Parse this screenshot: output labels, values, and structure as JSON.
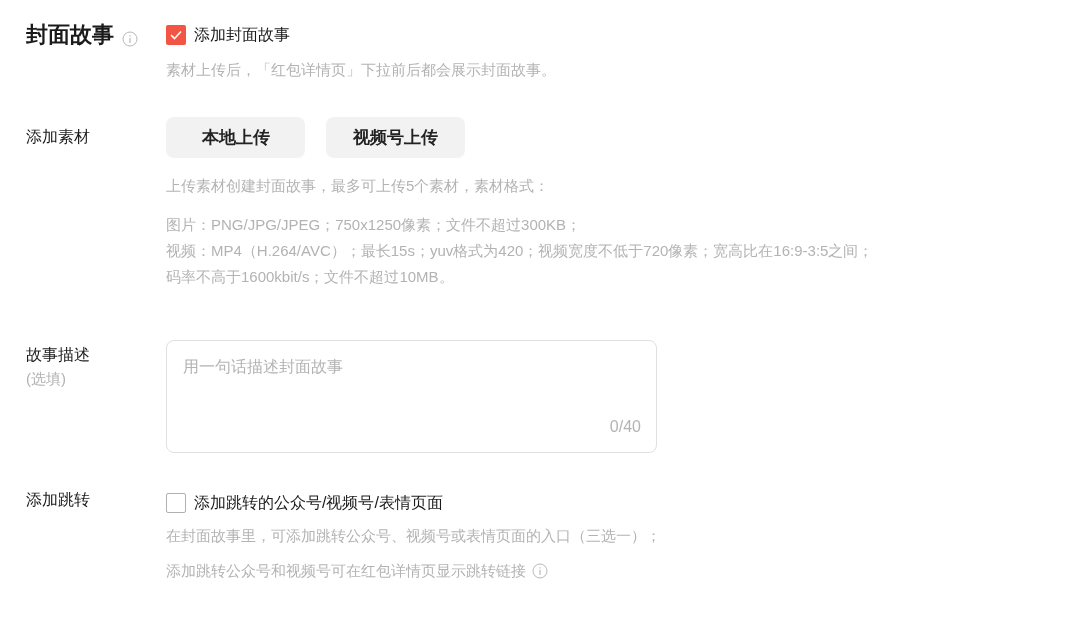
{
  "cover_story": {
    "title": "封面故事",
    "checkbox": {
      "label": "添加封面故事",
      "checked": true
    },
    "hint": "素材上传后，「红包详情页」下拉前后都会展示封面故事。"
  },
  "materials": {
    "label": "添加素材",
    "buttons": [
      "本地上传",
      "视频号上传"
    ],
    "hint": "上传素材创建封面故事，最多可上传5个素材，素材格式：",
    "formats": [
      "图片：PNG/JPG/JPEG；750x1250像素；文件不超过300KB；",
      "视频：MP4（H.264/AVC）；最长15s；yuv格式为420；视频宽度不低于720像素；宽高比在16:9-3:5之间；",
      "码率不高于1600kbit/s；文件不超过10MB。"
    ]
  },
  "description": {
    "label": "故事描述",
    "sublabel": "(选填)",
    "placeholder": "用一句话描述封面故事",
    "counter": "0/40"
  },
  "jump": {
    "label": "添加跳转",
    "checkbox": {
      "label": "添加跳转的公众号/视频号/表情页面",
      "checked": false
    },
    "hints": [
      "在封面故事里，可添加跳转公众号、视频号或表情页面的入口（三选一）；",
      "添加跳转公众号和视频号可在红包详情页显示跳转链接"
    ]
  }
}
